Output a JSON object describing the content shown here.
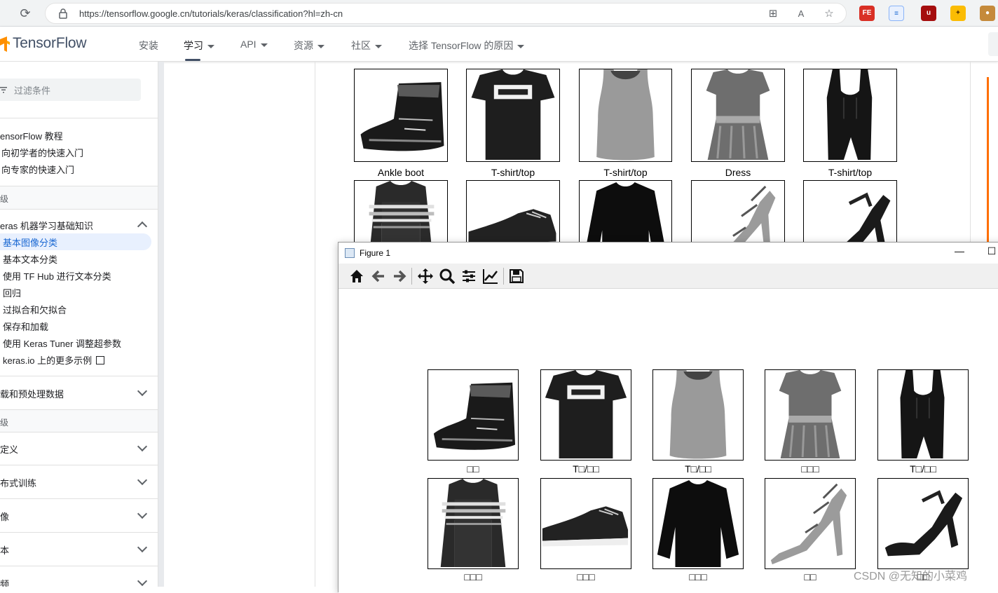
{
  "browser": {
    "url": "https://tensorflow.google.cn/tutorials/keras/classification?hl=zh-cn"
  },
  "header": {
    "brand": "TensorFlow",
    "nav": [
      {
        "label": "安装",
        "dropdown": false
      },
      {
        "label": "学习",
        "dropdown": true
      },
      {
        "label": "API",
        "dropdown": true
      },
      {
        "label": "资源",
        "dropdown": true
      },
      {
        "label": "社区",
        "dropdown": true
      },
      {
        "label": "选择 TensorFlow 的原因",
        "dropdown": true
      }
    ]
  },
  "sidebar": {
    "filter_placeholder": "过滤条件",
    "top_items": [
      "ensorFlow 教程",
      "向初学者的快速入门",
      "向专家的快速入门"
    ],
    "section_beginner": "级",
    "group_ml_basics": "eras 机器学习基础知识",
    "ml_items": [
      "基本图像分类",
      "基本文本分类",
      "使用 TF Hub 进行文本分类",
      "回归",
      "过拟合和欠拟合",
      "保存和加载",
      "使用 Keras Tuner 调整超参数",
      "keras.io 上的更多示例"
    ],
    "group_load_data": "载和预处理数据",
    "section_advanced": "级",
    "advanced_groups": [
      "定义",
      "布式训练",
      "像",
      "本",
      "频"
    ]
  },
  "page_grid": {
    "labels_row1": [
      "Ankle boot",
      "T-shirt/top",
      "T-shirt/top",
      "Dress",
      "T-shirt/top"
    ]
  },
  "figure": {
    "title": "Figure 1",
    "toolbar": [
      "home-icon",
      "back-icon",
      "forward-icon",
      "pan-icon",
      "zoom-icon",
      "subplots-icon",
      "axes-edit-icon",
      "save-icon"
    ],
    "labels_row1": [
      "□□",
      "T□/□□",
      "T□/□□",
      "□□□",
      "T□/□□"
    ],
    "labels_row2": [
      "□□□",
      "□□□",
      "□□□",
      "□□",
      "□□"
    ]
  },
  "watermark": "CSDN @无知的小菜鸡"
}
